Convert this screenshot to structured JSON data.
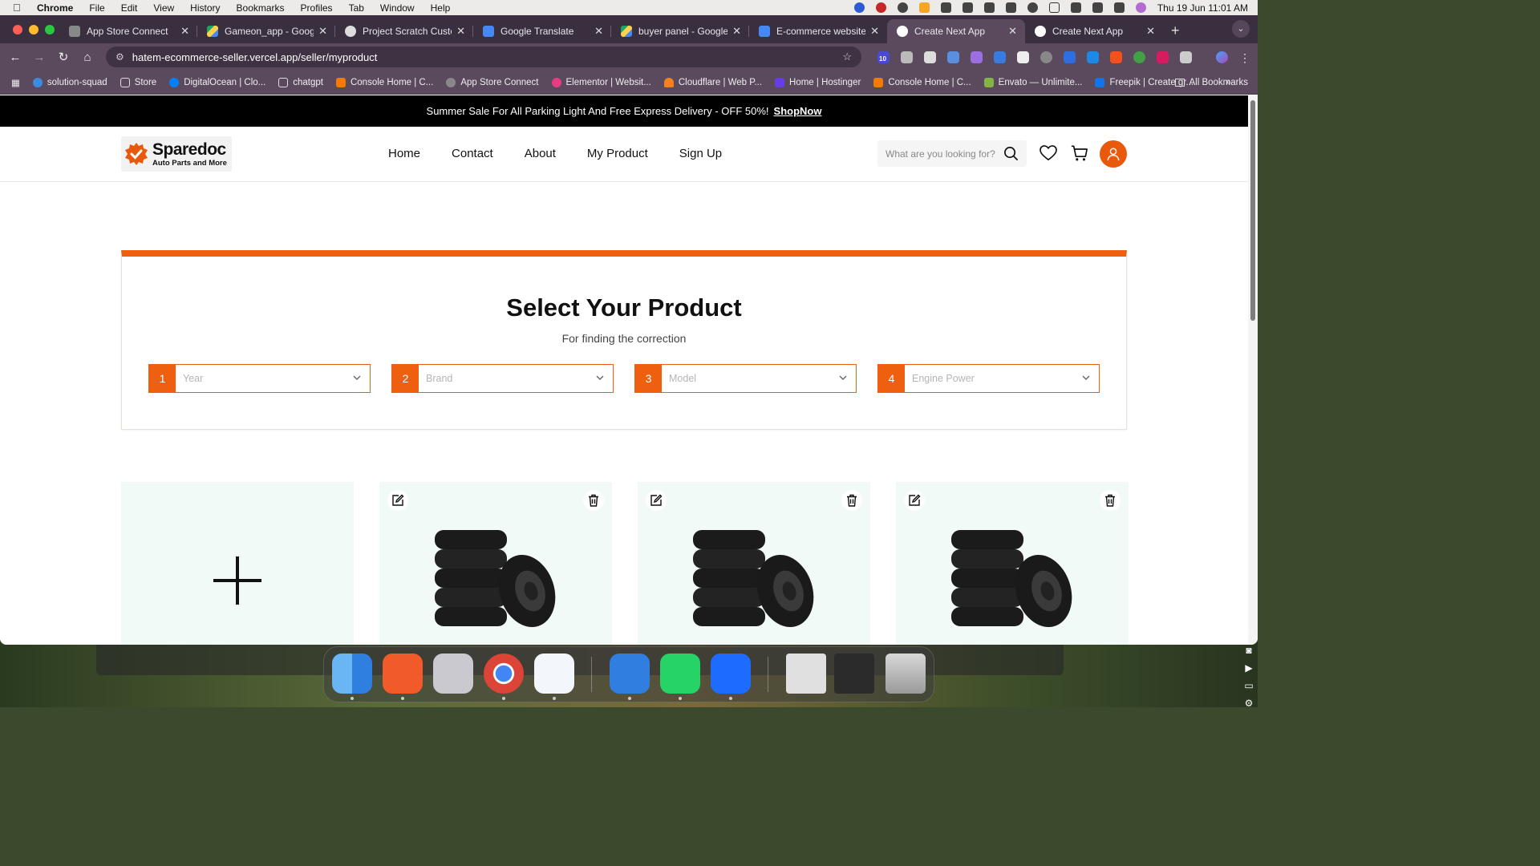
{
  "menubar": {
    "app": "Chrome",
    "items": [
      "File",
      "Edit",
      "View",
      "History",
      "Bookmarks",
      "Profiles",
      "Tab",
      "Window",
      "Help"
    ],
    "datetime": "Thu 19 Jun  11:01 AM"
  },
  "tabs": [
    {
      "title": "App Store Connect"
    },
    {
      "title": "Gameon_app - Google D"
    },
    {
      "title": "Project Scratch Customiz"
    },
    {
      "title": "Google Translate"
    },
    {
      "title": "buyer panel - Google Dri"
    },
    {
      "title": "E-commerce website - G"
    },
    {
      "title": "Create Next App"
    },
    {
      "title": "Create Next App"
    }
  ],
  "toolbar": {
    "url": "hatem-ecommerce-seller.vercel.app/seller/myproduct",
    "extension_badge": "10"
  },
  "bookmarks": {
    "items": [
      "solution-squad",
      "Store",
      "DigitalOcean | Clo...",
      "chatgpt",
      "Console Home | C...",
      "App Store Connect",
      "Elementor | Websit...",
      "Cloudflare | Web P...",
      "Home | Hostinger",
      "Console Home | C...",
      "Envato — Unlimite...",
      "Freepik | Create gr..."
    ],
    "more": "»",
    "all": "All Bookmarks"
  },
  "promo": {
    "text": "Summer Sale For All Parking Light And Free Express Delivery - OFF 50%!",
    "link": "ShopNow"
  },
  "header": {
    "logo_name": "Sparedoc",
    "logo_tagline": "Auto Parts and More",
    "nav": [
      "Home",
      "Contact",
      "About",
      "My Product",
      "Sign Up"
    ],
    "search_placeholder": "What are you looking for?"
  },
  "selector": {
    "title": "Select Your Product",
    "subtitle": "For finding the correction",
    "fields": [
      {
        "num": "1",
        "placeholder": "Year"
      },
      {
        "num": "2",
        "placeholder": "Brand"
      },
      {
        "num": "3",
        "placeholder": "Model"
      },
      {
        "num": "4",
        "placeholder": "Engine Power"
      }
    ]
  },
  "colors": {
    "accent": "#ef5f10",
    "card_bg": "#f1faf6"
  },
  "dock": {
    "apps": [
      "finder-icon",
      "pen-app-icon",
      "launchpad-icon",
      "chrome-icon",
      "app-store-icon",
      "xcode-icon",
      "whatsapp-icon",
      "zoom-icon",
      "document-icon",
      "screenshot-icon",
      "trash-icon"
    ]
  }
}
